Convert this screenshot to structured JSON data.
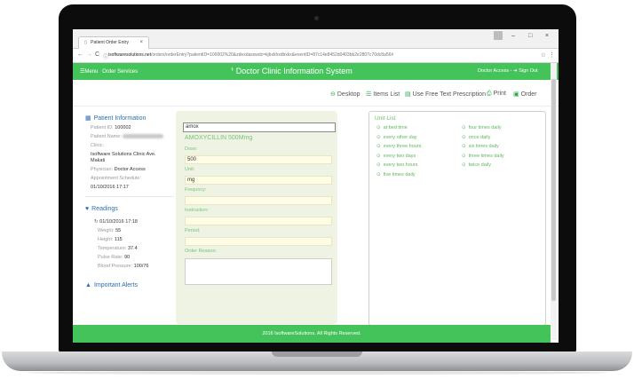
{
  "browser": {
    "tab_title": "Patient Order Entry",
    "tab_close": "×",
    "minimize": "–",
    "maximize": "□",
    "close": "×",
    "back": "←",
    "forward": "→",
    "reload": "C",
    "lock": "ⓘ",
    "url_domain": "isoftwaresolutions.net",
    "url_path": "/orders/orderEntry?patientID=100002%20&zdexdasswdz=kjbxkhxdbxkx&eventID=87c14e8452d0403bb2e2807c70dc8a56#",
    "star": "☆",
    "menu": "⋮"
  },
  "appbar": {
    "menu_label": "☰Menu",
    "order_services": "Order Services",
    "title": "Doctor Clinic Information System",
    "access": "Doctor Access",
    "signout": "Sign Out"
  },
  "toolbar": {
    "desktop": "Desktop",
    "items_list": "Items List",
    "free_text": "Use Free Text Prescription",
    "print": "Print",
    "order": "Order"
  },
  "patient": {
    "heading": "Patient Information",
    "id_label": "Patient ID:",
    "id_value": "100002",
    "name_label": "Patient Name:",
    "clinic_label": "Clinic:",
    "clinic_value_1": "Isoftware Solutions Clinic Ave.",
    "clinic_value_2": "Makati",
    "physician_label": "Physician:",
    "physician_value": "Doctor Access",
    "schedule_label": "Appointment Schedule:",
    "schedule_value": "01/10/2016 17:17"
  },
  "readings": {
    "heading": "Readings",
    "datetime": "01/10/2016 17:18",
    "weight_label": "Weight:",
    "weight_value": "55",
    "height_label": "Height:",
    "height_value": "115",
    "temp_label": "Temperature:",
    "temp_value": "37.4",
    "pulse_label": "Pulse Rate:",
    "pulse_value": "90",
    "bp_label": "Blood Pressure:",
    "bp_value": "100/76"
  },
  "alerts": {
    "heading": "Important Alerts"
  },
  "order_form": {
    "search_value": "amox",
    "drug_name": "AMOXYCILLIN 500Mmg",
    "dose_label": "Dose:",
    "dose_value": "500",
    "unit_label": "Unit:",
    "unit_value": "mg",
    "frequency_label": "Frequncy:",
    "instruction_label": "Instruction:",
    "period_label": "Period:",
    "reason_label": "Order Reason:"
  },
  "unit_list": {
    "title": "Unit List",
    "col1": [
      "at bed time",
      "every other day",
      "every three hours",
      "every two days",
      "every two hours",
      "five times daily"
    ],
    "col2": [
      "four times daily",
      "once daily",
      "six times daily",
      "three times daily",
      "twice daily"
    ]
  },
  "footer": {
    "text": "2016 IsoftwareSolutions. All Rights Reserved."
  },
  "colors": {
    "brand_green": "#44c35a",
    "link_blue": "#2b6fb6"
  }
}
